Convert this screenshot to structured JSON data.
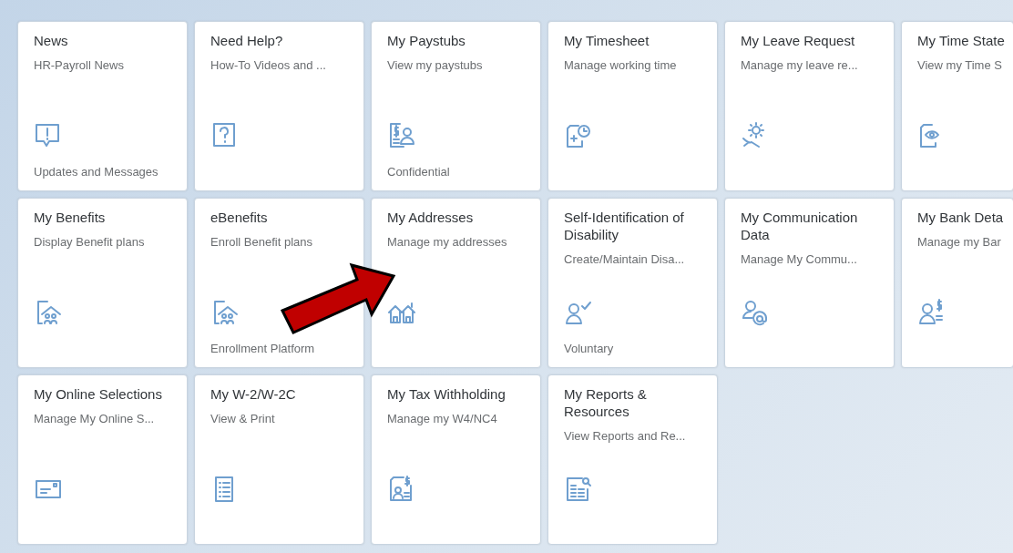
{
  "tiles": [
    {
      "title": "News",
      "subtitle": "HR-Payroll News",
      "footer": "Updates and Messages"
    },
    {
      "title": "Need Help?",
      "subtitle": "How-To Videos and ..."
    },
    {
      "title": "My Paystubs",
      "subtitle": "View my paystubs",
      "footer": "Confidential"
    },
    {
      "title": "My Timesheet",
      "subtitle": "Manage working time"
    },
    {
      "title": "My Leave Request",
      "subtitle": "Manage my leave re..."
    },
    {
      "title": "My Time State",
      "subtitle": "View my Time S"
    },
    {
      "title": "My Benefits",
      "subtitle": "Display Benefit plans"
    },
    {
      "title": "eBenefits",
      "subtitle": "Enroll Benefit plans",
      "footer": "Enrollment Platform"
    },
    {
      "title": "My Addresses",
      "subtitle": "Manage my addresses"
    },
    {
      "title": "Self-Identification of Disability",
      "subtitle": "Create/Maintain Disa...",
      "footer": "Voluntary"
    },
    {
      "title": "My Communication Data",
      "subtitle": "Manage My Commu..."
    },
    {
      "title": "My Bank Deta",
      "subtitle": "Manage my Bar"
    },
    {
      "title": "My Online Selections",
      "subtitle": "Manage My Online S..."
    },
    {
      "title": "My W-2/W-2C",
      "subtitle": "View & Print"
    },
    {
      "title": "My Tax Withholding",
      "subtitle": "Manage my W4/NC4"
    },
    {
      "title": "My Reports & Resources",
      "subtitle": "View Reports and Re..."
    }
  ]
}
